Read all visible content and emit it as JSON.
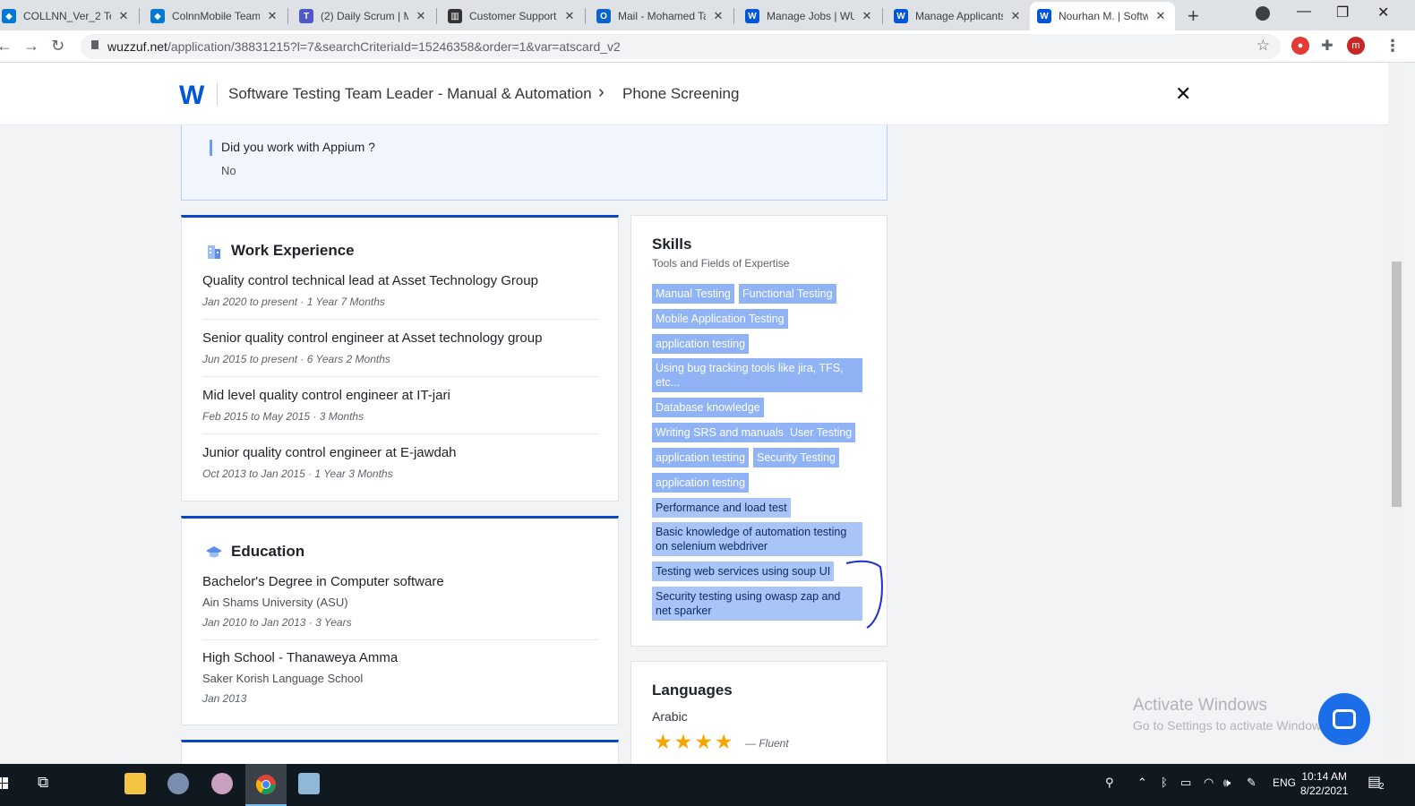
{
  "browser": {
    "tabs": [
      {
        "title": "COLLNN_Ver_2 Tea",
        "icon": "azure-devops-icon",
        "color": "#0078d4"
      },
      {
        "title": "ColnnMobile Team",
        "icon": "azure-devops-icon",
        "color": "#0078d4"
      },
      {
        "title": "(2) Daily Scrum | M",
        "icon": "teams-icon",
        "color": "#5059c9"
      },
      {
        "title": "Customer Support",
        "icon": "trello-icon",
        "color": "#333333"
      },
      {
        "title": "Mail - Mohamed Ta",
        "icon": "outlook-icon",
        "color": "#0a64c9"
      },
      {
        "title": "Manage Jobs | WU",
        "icon": "wuzzuf-icon",
        "color": "#0055d9"
      },
      {
        "title": "Manage Applicants",
        "icon": "wuzzuf-icon",
        "color": "#0055d9"
      },
      {
        "title": "Nourhan M. | Softw",
        "icon": "wuzzuf-icon",
        "color": "#0055d9"
      }
    ],
    "active_tab": 7,
    "url_domain": "wuzzuf.net",
    "url_path": "/application/38831215?l=7&searchCriteriaId=15246358&order=1&var=atscard_v2",
    "profile_initial": "m"
  },
  "header": {
    "logo": "W",
    "job_title": "Software Testing Team Leader - Manual & Automation",
    "stage": "Phone Screening"
  },
  "question": {
    "text": "Did you work with Appium ?",
    "answer": "No"
  },
  "work_experience": {
    "title": "Work Experience",
    "items": [
      {
        "role": "Quality control technical lead at Asset Technology Group",
        "dates": "Jan 2020 to present · 1 Year 7 Months"
      },
      {
        "role": "Senior quality control engineer at Asset technology group",
        "dates": "Jun 2015 to present · 6 Years 2 Months"
      },
      {
        "role": "Mid level quality control engineer at IT-jari",
        "dates": "Feb 2015 to May 2015 · 3 Months"
      },
      {
        "role": "Junior quality control engineer at E-jawdah",
        "dates": "Oct 2013 to Jan 2015 · 1 Year 3 Months"
      }
    ]
  },
  "education": {
    "title": "Education",
    "items": [
      {
        "degree": "Bachelor's Degree in Computer software",
        "school": "Ain Shams University (ASU)",
        "dates": "Jan 2010 to Jan 2013 · 3 Years"
      },
      {
        "degree": "High School - Thanaweya Amma",
        "school": "Saker Korish Language School",
        "dates": "Jan 2013"
      }
    ]
  },
  "skills": {
    "title": "Skills",
    "subtitle": "Tools and Fields of Expertise",
    "chips": [
      "Manual Testing",
      "Functional Testing",
      "Mobile Application Testing",
      "application testing",
      "Using bug tracking tools like jira, TFS, etc...",
      "Database knowledge",
      "Writing SRS and manuals",
      "User Testing",
      "application testing",
      "Security Testing",
      "application testing",
      "Performance and load test",
      "Basic knowledge of automation testing on selenium webdriver",
      "Testing web services using soup UI",
      "Security testing using owasp zap and net sparker"
    ]
  },
  "languages": {
    "title": "Languages",
    "items": [
      {
        "name": "Arabic",
        "stars": "★★★★",
        "rating": 4,
        "level": "— Fluent"
      }
    ]
  },
  "watermark": {
    "line1": "Activate Windows",
    "line2": "Go to Settings to activate Windows."
  },
  "taskbar": {
    "lang": "ENG",
    "time": "10:14 AM",
    "date": "8/22/2021",
    "notifications": "2"
  }
}
